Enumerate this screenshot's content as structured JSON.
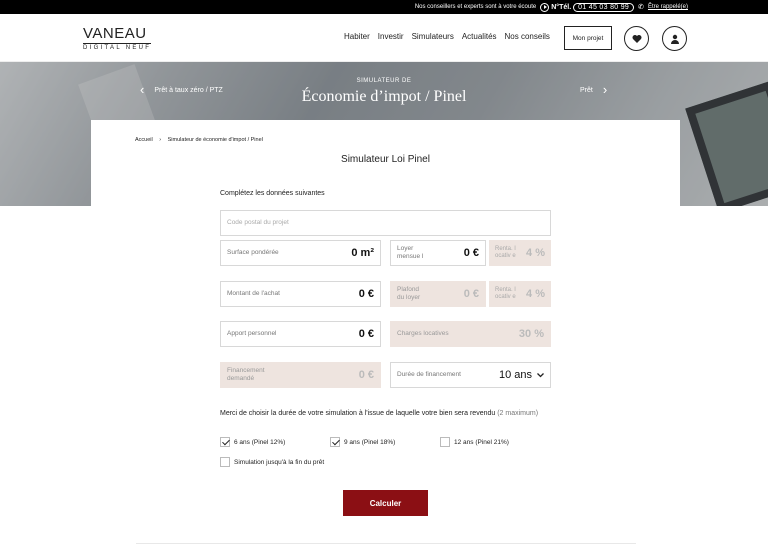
{
  "topbar": {
    "text": "Nos conseillers et experts sont à votre écoute",
    "tel_label": "N°Tél.",
    "phone": "01 45 03 80 99",
    "callback": "Être rappelé(e)"
  },
  "logo": {
    "line1": "VANEAU",
    "line2": "DIGITAL NEUF"
  },
  "nav": [
    "Habiter",
    "Investir",
    "Simulateurs",
    "Actualités",
    "Nos conseils"
  ],
  "mon_projet": "Mon projet",
  "hero": {
    "subtitle": "SIMULATEUR DE",
    "title": "Économie d’impot / Pinel",
    "prev": "Prêt à taux zéro / PTZ",
    "next": "Prêt"
  },
  "breadcrumb": {
    "home": "Accueil",
    "sep": "›",
    "current": "Simulateur de économie d'impot / Pinel"
  },
  "card_title": "Simulateur Loi Pinel",
  "intro": "Complétez les données suivantes",
  "form": {
    "postal_placeholder": "Code postal du projet",
    "surface_label": "Surface pondérée",
    "surface_value": "0 m²",
    "loyer_label": "Loyer mensue l",
    "loyer_value": "0 €",
    "renta1_label": "Renta. locativ e",
    "renta1_value": "4 %",
    "achat_label": "Montant de l'achat",
    "achat_value": "0 €",
    "plafond_label": "Plafond du loyer",
    "plafond_value": "0 €",
    "renta2_label": "Renta. locativ e",
    "renta2_value": "4 %",
    "apport_label": "Apport personnel",
    "apport_value": "0 €",
    "charges_label": "Charges locatives",
    "charges_value": "30 %",
    "financement_label": "Financement demandé",
    "financement_value": "0 €",
    "duree_label": "Durée de financement",
    "duree_value": "10 ans"
  },
  "question": {
    "text": "Merci de choisir la durée de votre simulation à l'issue de laquelle votre bien sera revendu",
    "hint": "(2 maximum)"
  },
  "options": [
    {
      "label": "6 ans (Pinel 12%)",
      "checked": true
    },
    {
      "label": "9 ans (Pinel 18%)",
      "checked": true
    },
    {
      "label": "12 ans (Pinel 21%)",
      "checked": false
    },
    {
      "label": "Simulation jusqu'à la fin du prêt",
      "checked": false
    }
  ],
  "submit": "Calculer"
}
